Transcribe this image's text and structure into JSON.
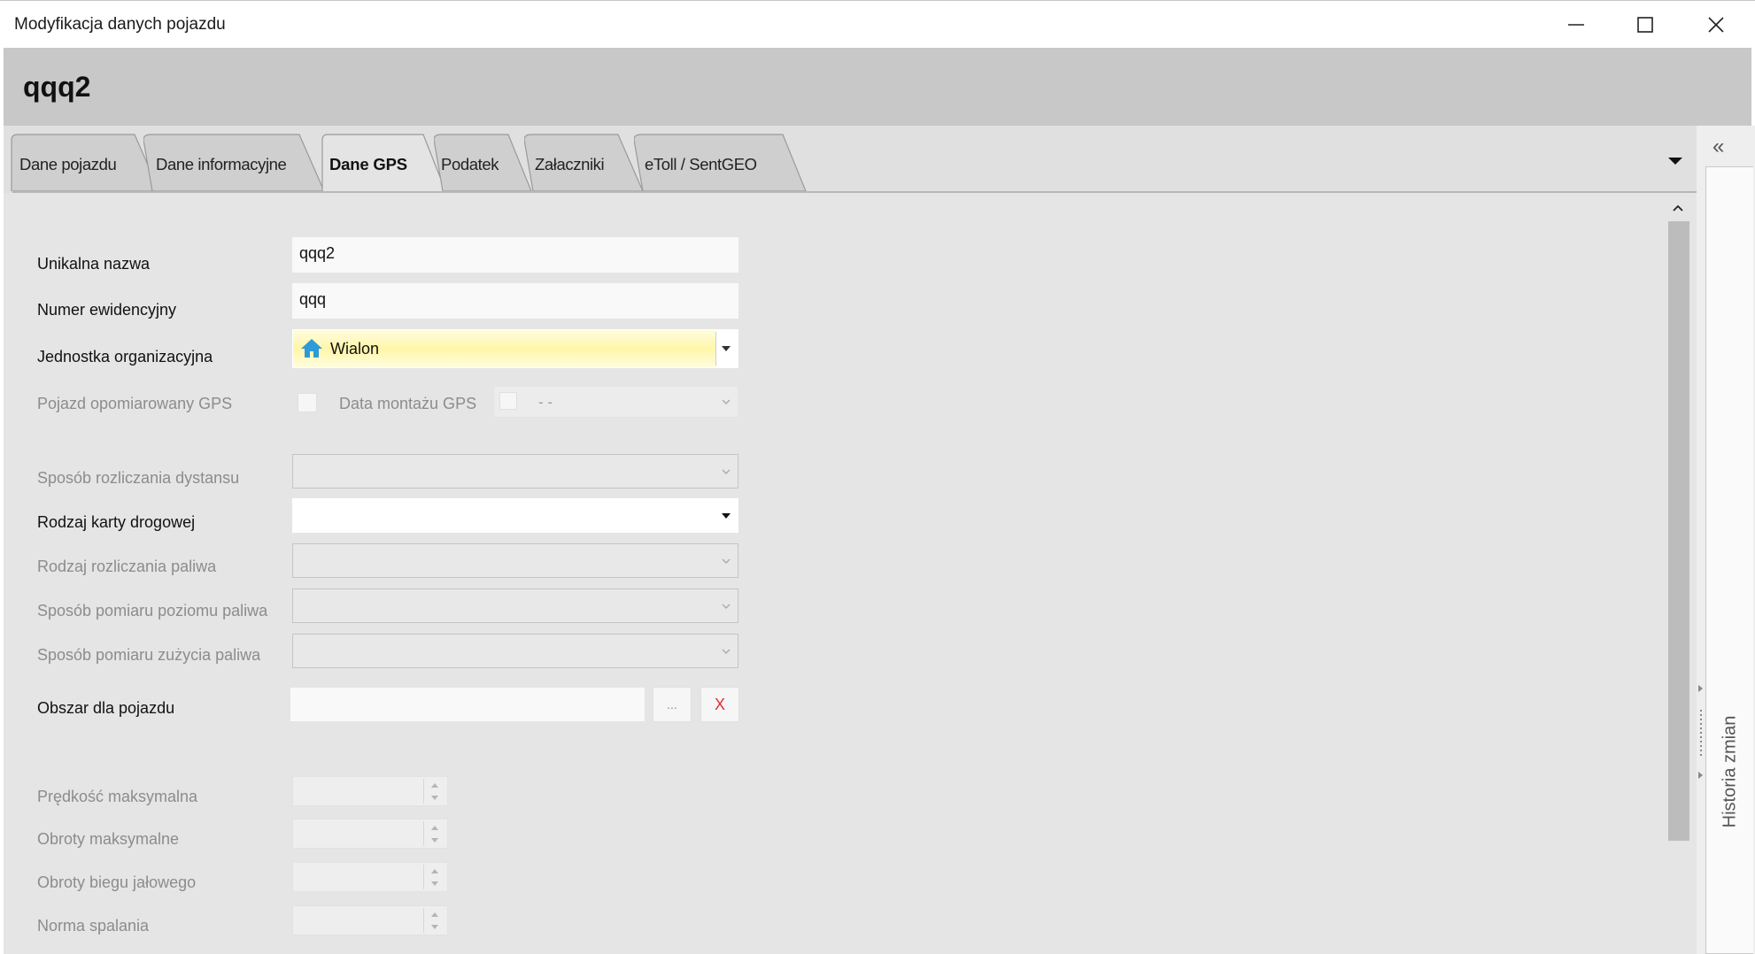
{
  "window": {
    "title": "Modyfikacja danych pojazdu",
    "minimize_icon": "minimize-icon",
    "maximize_icon": "maximize-icon",
    "close_icon": "close-icon"
  },
  "header": {
    "title": "qqq2"
  },
  "tabs": [
    {
      "label": "Dane pojazdu",
      "active": false
    },
    {
      "label": "Dane informacyjne",
      "active": false
    },
    {
      "label": "Dane GPS",
      "active": true
    },
    {
      "label": "Podatek",
      "active": false
    },
    {
      "label": "Załaczniki",
      "active": false
    },
    {
      "label": "eToll / SentGEO",
      "active": false
    }
  ],
  "form": {
    "unique_name": {
      "label": "Unikalna nazwa",
      "value": "qqq2"
    },
    "reg_number": {
      "label": "Numer ewidencyjny",
      "value": "qqq"
    },
    "org_unit": {
      "label": "Jednostka organizacyjna",
      "value": "Wialon",
      "icon": "house-icon"
    },
    "gps_vehicle": {
      "label": "Pojazd opomiarowany GPS",
      "checked": false
    },
    "gps_mount_date": {
      "label": "Data montażu GPS",
      "value": "-  -"
    },
    "distance_method": {
      "label": "Sposób rozliczania dystansu",
      "value": ""
    },
    "road_card_type": {
      "label": "Rodzaj karty drogowej",
      "value": ""
    },
    "fuel_settlement": {
      "label": "Rodzaj rozliczania paliwa",
      "value": ""
    },
    "fuel_level_method": {
      "label": "Sposób pomiaru poziomu paliwa",
      "value": ""
    },
    "fuel_usage_method": {
      "label": "Sposób pomiaru zużycia paliwa",
      "value": ""
    },
    "vehicle_area": {
      "label": "Obszar dla pojazdu",
      "value": "",
      "browse_label": "...",
      "clear_label": "X"
    },
    "max_speed": {
      "label": "Prędkość maksymalna",
      "value": ""
    },
    "max_rpm": {
      "label": "Obroty maksymalne",
      "value": ""
    },
    "idle_rpm": {
      "label": "Obroty biegu jałowego",
      "value": ""
    },
    "fuel_norm": {
      "label": "Norma spalania",
      "value": ""
    }
  },
  "side_panel": {
    "collapse_label": "«",
    "title": "Historia zmian"
  },
  "colors": {
    "accent_blue": "#2e9ad8",
    "clear_red": "#e03030",
    "selected_yellow": "#fff6a8"
  }
}
